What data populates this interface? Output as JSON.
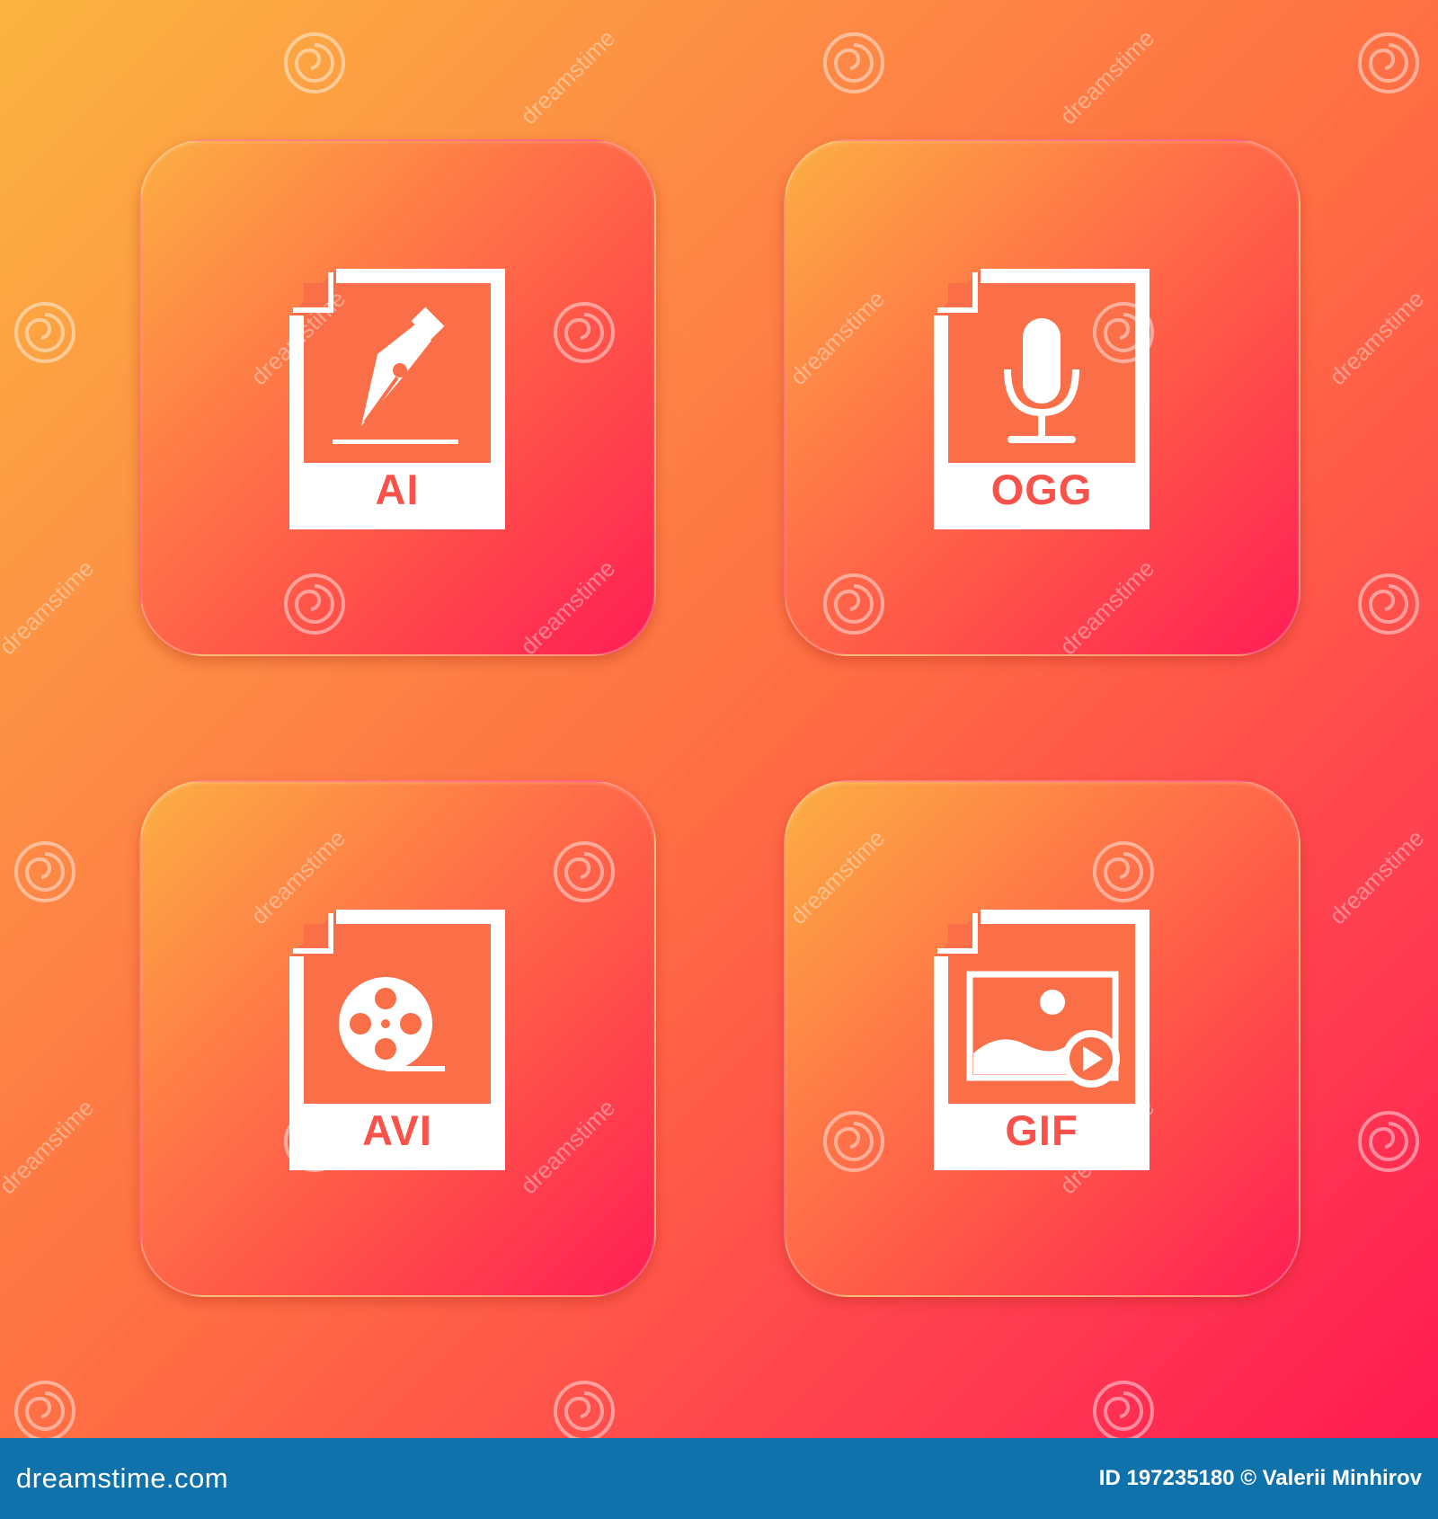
{
  "icons": [
    {
      "label": "AI",
      "glyph": "pen-nib-icon"
    },
    {
      "label": "OGG",
      "glyph": "microphone-icon"
    },
    {
      "label": "AVI",
      "glyph": "film-reel-icon"
    },
    {
      "label": "GIF",
      "glyph": "image-play-icon"
    }
  ],
  "watermark": {
    "brand": "dreamstime",
    "glyph": "spiral-logo-icon"
  },
  "footer": {
    "site": "dreamstime.com",
    "credit": "ID 197235180 © Valerii Minhirov"
  },
  "colors": {
    "gradient_top_left": "#fbb540",
    "gradient_bottom_right": "#ff1a52",
    "icon_fill": "#ffffff",
    "label_red": "#f9524a",
    "footer_bar": "#0f72ab"
  }
}
